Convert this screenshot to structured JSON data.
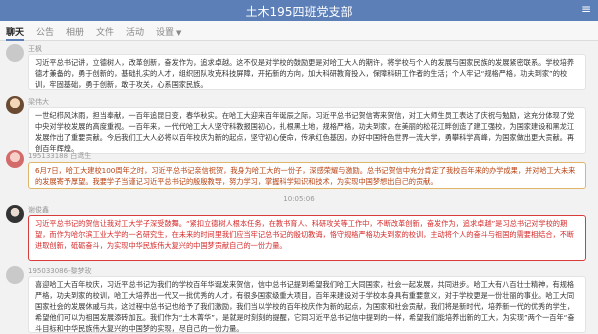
{
  "window": {
    "title": "土木195四班党支部",
    "menu_icon": "more-icon"
  },
  "tabs": [
    {
      "label": "聊天"
    },
    {
      "label": "公告"
    },
    {
      "label": "相册"
    },
    {
      "label": "文件"
    },
    {
      "label": "活动"
    },
    {
      "label": "设置"
    }
  ],
  "messages": [
    {
      "sender": "王枫",
      "text": "习近平总书记讲，立德树人，改革创新，奋发作为，追求卓越。这不仅是对学校的鼓励更是对哈工大人的期许，将学校与个人的发展与国家民族的发展紧密联系。学校培养德才兼备的，勇于创新的，基础扎实的人才，组织团队攻克科技屏障，开拓新的方向，加大科研教育投入，保障科研工作者的生活；个人牢记“规格严格，功夫到家”的校训，牢固基础，勇于创新，敢于攻关，心系国家民族。"
    },
    {
      "sender": "梁伟大",
      "text": "一世纪栉风沐雨，担当奉献，一百年追昆日变，春华秋实。在哈工大迎来百年诞辰之际，习近平总书记贺信寄来贺信，对工大师生员工表达了庆祝与勉励，这充分体现了党中央对学校发展的高度重视。一百年来，一代代哈工大人坚守科教报国初心，扎根黑土地，规格严格，功夫到家，在美丽的松花江畔创造了建工强校，为国家建设和黑龙江发展作出了重要贡献。今后我们工大人必将以百年校庆为新的起点，坚守初心使命，传承红色基因，办好中国特色世界一流大学，勇攀科学高峰，为国家做出更大贡献。再创百年辉煌。"
    },
    {
      "sender": "195133188 白鸢生",
      "text": "6月7日，哈工大建校100周年之时，习近平总书记亲信祝贺，我身为哈工大的一份子，深感荣耀与激励。总书记贺信中充分肯定了我校百年来的办学成果，并对哈工大未来的发展寄予厚望。我要学子当谨记习近平总书记的殷殷教导，努力学习，掌握科学知识和技术，为实现中国梦想出自己的贡献。"
    },
    {
      "sender": "谢俊鑫",
      "text": "习近平总书记的贺信让我对工大学子深受鼓舞。“紧扣立德树人根本任务，在教书育人、科研攻关等工作中，不断改革创新，奋发作为，追求卓越”是习总书记对学校的期望，而作为哈尔滨工业大学的一名研究生，在未来的时间里我们应当牢记总书记的殷切教诲，恪守规格严格功夫到家的校训，主动将个人的奋斗与祖国的需要相结合，不断进取创新，砥砺奋斗，为实现中华民族伟大复兴的中国梦贡献自己的一份力量。"
    },
    {
      "sender": "195033086-黎梦玫",
      "text": "喜迎哈工大百年校庆，习近平总书记为我们的学校百年华诞发来贺信，信中总书记提到希望我们哈工大同国家，社会一起发展，共同进步。哈工大有八百壮士精神，有规格严格，功夫到家的校训，哈工大培养出一代又一批优秀的人才，有很多国家级重大项目，百年来建设对于学校本身具有重要意义，对于学校更是一份壮丽的事业。哈工大同国家社会的发展休戚与共，这过程中总书记也给予了我们激励，我们当以学校的百年校庆作为新的起点，为国家和社会贡献，我们将是新时代，培养新一代的优秀的学生，希望他们可以为祖国发展添砖加瓦。我们作为“土木菁华”，是就是时刻刻的提醒，它同习近平总书记信中提到的一样，希望我们能培养出新的工大，为实现”两个一百年“奋斗目标和中华民族伟大复兴的中国梦的实现，尽自己的一份力量。"
    }
  ],
  "time_divider": "10:05:06"
}
